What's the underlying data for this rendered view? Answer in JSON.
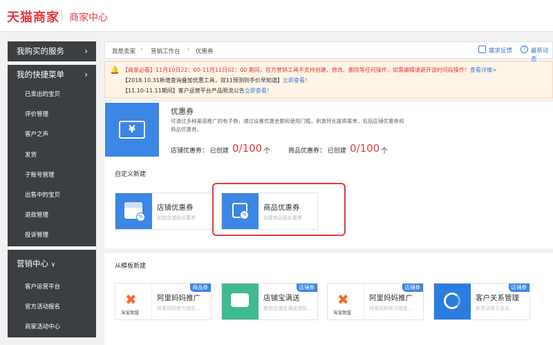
{
  "header": {
    "brand": "天猫商家",
    "center_title": "商家中心"
  },
  "sidebar": {
    "my_services": "我购买的服务",
    "quick_menu": "我的快捷菜单",
    "quick_items": [
      "已卖出的宝贝",
      "评价管理",
      "客户之声",
      "发货",
      "子账号管理",
      "出售中的宝贝",
      "退款管理",
      "投诉管理"
    ],
    "marketing_center": "营销中心",
    "marketing_items": [
      "客户运营平台",
      "官方活动报名",
      "商家活动中心"
    ]
  },
  "breadcrumb": {
    "items": [
      "我是卖家",
      "营销工作台",
      "优惠券"
    ],
    "feedback": "需求反馈",
    "latest": "最新动态"
  },
  "notice": {
    "line1_red": "【商家必看】11月10日22：00-11月11日02：00 期间，官方营销工具不支持创建、修改、删除等任何操作，如需编辑请避开该时间段操作！",
    "line1_link": "查看详情>",
    "line2": "【2018.10.31新增查询叠加优惠工具，双11预测到手价早知道】",
    "line2_link": "立即查看！",
    "line3": "【11.10-11.11期间】客户运营平台产品限流公告",
    "line3_link": "立即查看！"
  },
  "coupon_intro": {
    "logo_glyph": "¥",
    "title": "优惠券",
    "description": "可通过多种渠道推广的电子券，通过设置优惠金额和使用门槛，刺激转化提高客单，包括店铺优惠券和商品优惠券。",
    "shop_label": "店铺优惠券：  已创建",
    "shop_value": "0/100",
    "item_label": "商品优惠券：  已创建",
    "item_value": "0/100",
    "unit": "个"
  },
  "custom_section": {
    "title": "自定义新建",
    "cards": [
      {
        "title": "店铺优惠券",
        "desc": "创建店铺级优惠券"
      },
      {
        "title": "商品优惠券",
        "desc": "创建商品级优惠券"
      }
    ]
  },
  "template_section": {
    "title": "从模板新建",
    "cards": [
      {
        "title": "阿里妈妈推广",
        "desc": "阿里妈妈官方指定...",
        "tag": "商品券",
        "icon_label": "淘宝联盟"
      },
      {
        "title": "店铺宝满送",
        "desc": "使用店铺宝满送搭配...",
        "tag": "店铺券"
      },
      {
        "title": "阿里妈妈推广",
        "desc": "阿里妈妈官方指定...",
        "tag": "店铺券",
        "icon_label": "淘宝联盟"
      },
      {
        "title": "客户关系管理",
        "desc": "此券适用于会员...",
        "tag": "店铺券"
      }
    ]
  },
  "colors": {
    "accent_red": "#e4393c",
    "primary_blue": "#3d86e6",
    "sidebar_bg": "#3c3f41"
  }
}
